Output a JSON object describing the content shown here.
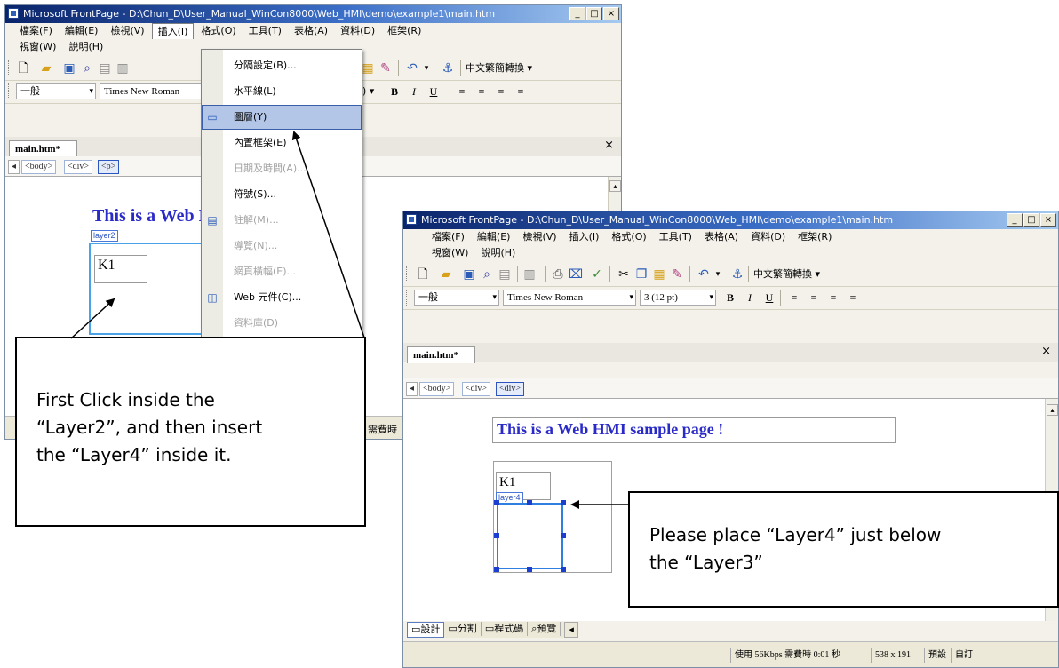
{
  "left_window": {
    "title": "Microsoft FrontPage - D:\\Chun_D\\User_Manual_WinCon8000\\Web_HMI\\demo\\example1\\main.htm",
    "menu_row1": [
      "檔案(F)",
      "編輯(E)",
      "檢視(V)",
      "插入(I)",
      "格式(O)",
      "工具(T)",
      "表格(A)",
      "資料(D)",
      "框架(R)"
    ],
    "menu_row2": [
      "視窗(W)",
      "說明(H)"
    ],
    "open_menu": "插入(I)",
    "toolbar_text": "中文繁簡轉換",
    "style_combo": "一般",
    "font_combo": "Times New Roman",
    "size_combo": "3 (12 pt)",
    "doc_tab": "main.htm*",
    "tags": [
      "<body>",
      "<div>",
      "<p>"
    ],
    "heading": "This is a Web HMI sample page !",
    "layer_label": "layer2",
    "k1_text": "K1",
    "status_fragment": "需費時",
    "dropdown": [
      {
        "label": "分隔設定(B)...",
        "state": "normal",
        "icon": ""
      },
      {
        "label": "水平線(L)",
        "state": "normal",
        "icon": ""
      },
      {
        "label": "圖層(Y)",
        "state": "highlighted",
        "icon": "layer-icon"
      },
      {
        "label": "內置框架(E)",
        "state": "normal",
        "icon": ""
      },
      {
        "label": "日期及時間(A)...",
        "state": "disabled",
        "icon": ""
      },
      {
        "label": "符號(S)...",
        "state": "normal",
        "icon": ""
      },
      {
        "label": "註解(M)...",
        "state": "disabled",
        "icon": "comment-icon"
      },
      {
        "label": "導覽(N)...",
        "state": "disabled",
        "icon": ""
      },
      {
        "label": "網頁橫幅(E)...",
        "state": "disabled",
        "icon": ""
      },
      {
        "label": "Web 元件(C)...",
        "state": "normal",
        "icon": "web-component-icon"
      },
      {
        "label": "資料庫(D)",
        "state": "disabled",
        "icon": ""
      }
    ]
  },
  "right_window": {
    "title": "Microsoft FrontPage - D:\\Chun_D\\User_Manual_WinCon8000\\Web_HMI\\demo\\example1\\main.htm",
    "menu_row1": [
      "檔案(F)",
      "編輯(E)",
      "檢視(V)",
      "插入(I)",
      "格式(O)",
      "工具(T)",
      "表格(A)",
      "資料(D)",
      "框架(R)"
    ],
    "menu_row2": [
      "視窗(W)",
      "說明(H)"
    ],
    "toolbar_text": "中文繁簡轉換",
    "style_combo": "一般",
    "font_combo": "Times New Roman",
    "size_combo": "3 (12 pt)",
    "doc_tab": "main.htm*",
    "tags": [
      "<body>",
      "<div>",
      "<div>"
    ],
    "heading": "This is a Web HMI sample page !",
    "k1_text": "K1",
    "layer_label": "layer4",
    "bottom_tabs": [
      "設計",
      "分割",
      "程式碼",
      "預覽"
    ],
    "status": [
      "使用 56Kbps 需費時 0:01 秒",
      "538 x 191",
      "預設",
      "自訂"
    ]
  },
  "callouts": {
    "left": [
      "First Click inside the",
      "“Layer2”, and then insert",
      "the “Layer4” inside it."
    ],
    "right": [
      "Please place “Layer4” just below",
      "the “Layer3”"
    ]
  }
}
